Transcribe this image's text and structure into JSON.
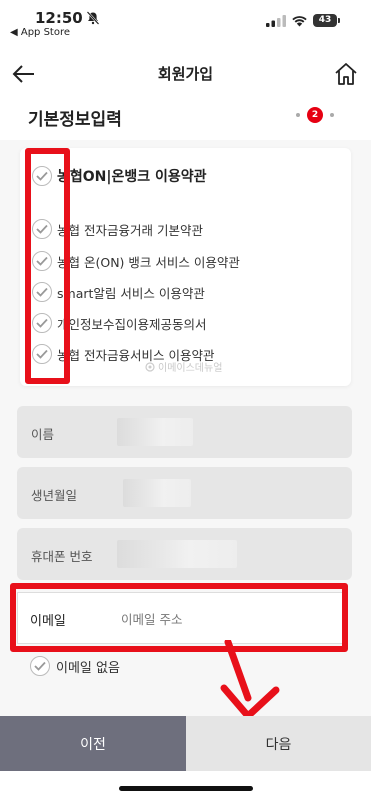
{
  "status_bar": {
    "time": "12:50",
    "back_app": "◀ App Store",
    "battery": "43"
  },
  "header": {
    "title": "회원가입"
  },
  "section": {
    "title": "기본정보입력",
    "current_step": "2"
  },
  "terms": {
    "main": "농협ON|온뱅크 이용약관",
    "items": [
      "농협 전자금융거래 기본약관",
      "농협 온(ON) 뱅크 서비스 이용약관",
      "smart알림 서비스 이용약관",
      "개인정보수집이용제공동의서",
      "농협 전자금융서비스 이용약관"
    ]
  },
  "watermark": "이메이스데뉴얼",
  "form": {
    "name_label": "이름",
    "birth_label": "생년월일",
    "phone_label": "휴대폰 번호",
    "email_label": "이메일",
    "email_placeholder": "이메일 주소",
    "email_value": "",
    "no_email_label": "이메일 없음"
  },
  "buttons": {
    "prev": "이전",
    "next": "다음"
  },
  "colors": {
    "accent_red": "#e60012",
    "annotation_red": "#e8101a",
    "prev_button": "#6e6f7d",
    "next_button": "#e5e5e5"
  }
}
